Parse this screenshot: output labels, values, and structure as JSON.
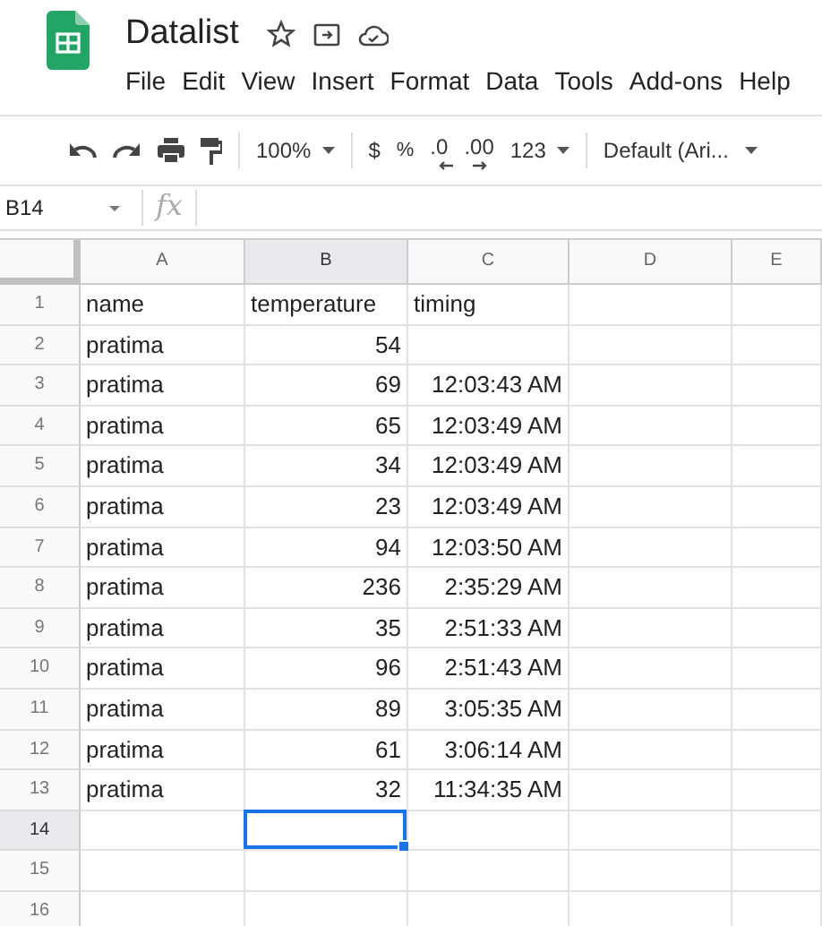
{
  "document": {
    "title": "Datalist"
  },
  "menu": [
    "File",
    "Edit",
    "View",
    "Insert",
    "Format",
    "Data",
    "Tools",
    "Add-ons",
    "Help"
  ],
  "toolbar": {
    "zoom": "100%",
    "currency": "$",
    "percent": "%",
    "decrease_decimals": ".0",
    "increase_decimals": ".00",
    "number_format": "123",
    "font": "Default (Ari..."
  },
  "formula_bar": {
    "cell_reference": "B14",
    "fx": "fx"
  },
  "columns": [
    {
      "label": "A",
      "selected": false
    },
    {
      "label": "B",
      "selected": true
    },
    {
      "label": "C",
      "selected": false
    },
    {
      "label": "D",
      "selected": false
    },
    {
      "label": "E",
      "selected": false
    }
  ],
  "rows": [
    {
      "label": "1",
      "selected": false,
      "cells": [
        {
          "text": "name",
          "kind": "text"
        },
        {
          "text": "temperature",
          "kind": "text"
        },
        {
          "text": "timing",
          "kind": "text"
        }
      ]
    },
    {
      "label": "2",
      "selected": false,
      "cells": [
        {
          "text": "pratima",
          "kind": "text"
        },
        {
          "text": "54",
          "kind": "number"
        }
      ]
    },
    {
      "label": "3",
      "selected": false,
      "cells": [
        {
          "text": "pratima",
          "kind": "text"
        },
        {
          "text": "69",
          "kind": "number"
        },
        {
          "text": "12:03:43 AM",
          "kind": "time"
        }
      ]
    },
    {
      "label": "4",
      "selected": false,
      "cells": [
        {
          "text": "pratima",
          "kind": "text"
        },
        {
          "text": "65",
          "kind": "number"
        },
        {
          "text": "12:03:49 AM",
          "kind": "time"
        }
      ]
    },
    {
      "label": "5",
      "selected": false,
      "cells": [
        {
          "text": "pratima",
          "kind": "text"
        },
        {
          "text": "34",
          "kind": "number"
        },
        {
          "text": "12:03:49 AM",
          "kind": "time"
        }
      ]
    },
    {
      "label": "6",
      "selected": false,
      "cells": [
        {
          "text": "pratima",
          "kind": "text"
        },
        {
          "text": "23",
          "kind": "number"
        },
        {
          "text": "12:03:49 AM",
          "kind": "time"
        }
      ]
    },
    {
      "label": "7",
      "selected": false,
      "cells": [
        {
          "text": "pratima",
          "kind": "text"
        },
        {
          "text": "94",
          "kind": "number"
        },
        {
          "text": "12:03:50 AM",
          "kind": "time"
        }
      ]
    },
    {
      "label": "8",
      "selected": false,
      "cells": [
        {
          "text": "pratima",
          "kind": "text"
        },
        {
          "text": "236",
          "kind": "number"
        },
        {
          "text": "2:35:29 AM",
          "kind": "time"
        }
      ]
    },
    {
      "label": "9",
      "selected": false,
      "cells": [
        {
          "text": "pratima",
          "kind": "text"
        },
        {
          "text": "35",
          "kind": "number"
        },
        {
          "text": "2:51:33 AM",
          "kind": "time"
        }
      ]
    },
    {
      "label": "10",
      "selected": false,
      "cells": [
        {
          "text": "pratima",
          "kind": "text"
        },
        {
          "text": "96",
          "kind": "number"
        },
        {
          "text": "2:51:43 AM",
          "kind": "time"
        }
      ]
    },
    {
      "label": "11",
      "selected": false,
      "cells": [
        {
          "text": "pratima",
          "kind": "text"
        },
        {
          "text": "89",
          "kind": "number"
        },
        {
          "text": "3:05:35 AM",
          "kind": "time"
        }
      ]
    },
    {
      "label": "12",
      "selected": false,
      "cells": [
        {
          "text": "pratima",
          "kind": "text"
        },
        {
          "text": "61",
          "kind": "number"
        },
        {
          "text": "3:06:14 AM",
          "kind": "time"
        }
      ]
    },
    {
      "label": "13",
      "selected": false,
      "cells": [
        {
          "text": "pratima",
          "kind": "text"
        },
        {
          "text": "32",
          "kind": "number"
        },
        {
          "text": "11:34:35 AM",
          "kind": "time"
        }
      ]
    },
    {
      "label": "14",
      "selected": true
    },
    {
      "label": "15",
      "selected": false
    },
    {
      "label": "16",
      "selected": false
    }
  ]
}
